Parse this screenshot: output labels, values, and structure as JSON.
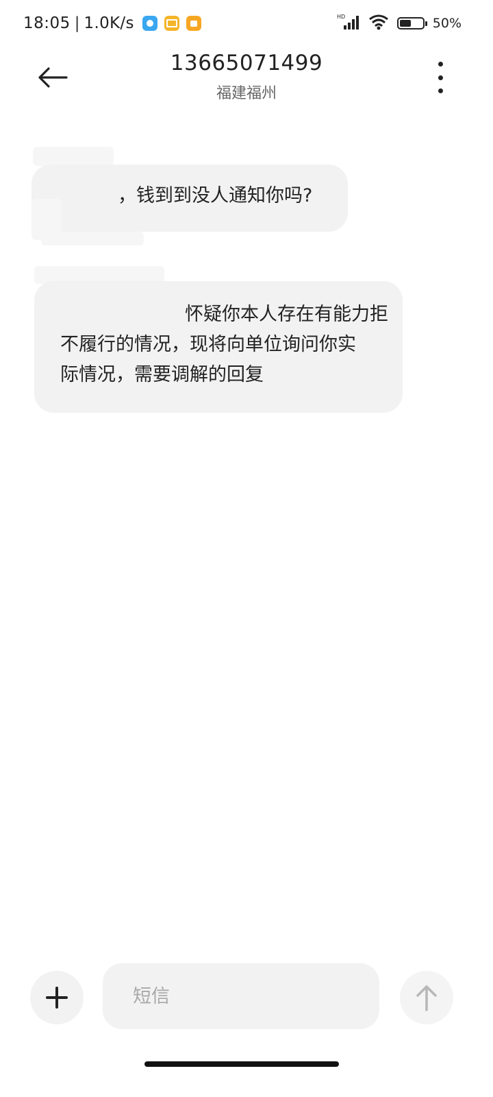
{
  "status_bar": {
    "time": "18:05",
    "separator": "|",
    "net_speed": "1.0K/s",
    "network_label": "HD",
    "battery_percent": 50,
    "battery_text": "50%",
    "notification_icons": [
      "qq-browser-icon",
      "mail-icon",
      "notes-icon"
    ]
  },
  "header": {
    "title": "13665071499",
    "subtitle": "福建福州"
  },
  "messages": [
    {
      "lines": [
        "，钱到到没人通知你吗?"
      ]
    },
    {
      "lines": [
        "怀疑你本人存在有能力拒",
        "不履行的情况，现将向单位询问你实",
        "际情况，需要调解的回复"
      ]
    }
  ],
  "composer": {
    "placeholder": "短信"
  },
  "colors": {
    "bubble_bg": "#f2f2f2",
    "text": "#222222",
    "subtitle": "#666666",
    "placeholder": "#a8a8a8"
  }
}
